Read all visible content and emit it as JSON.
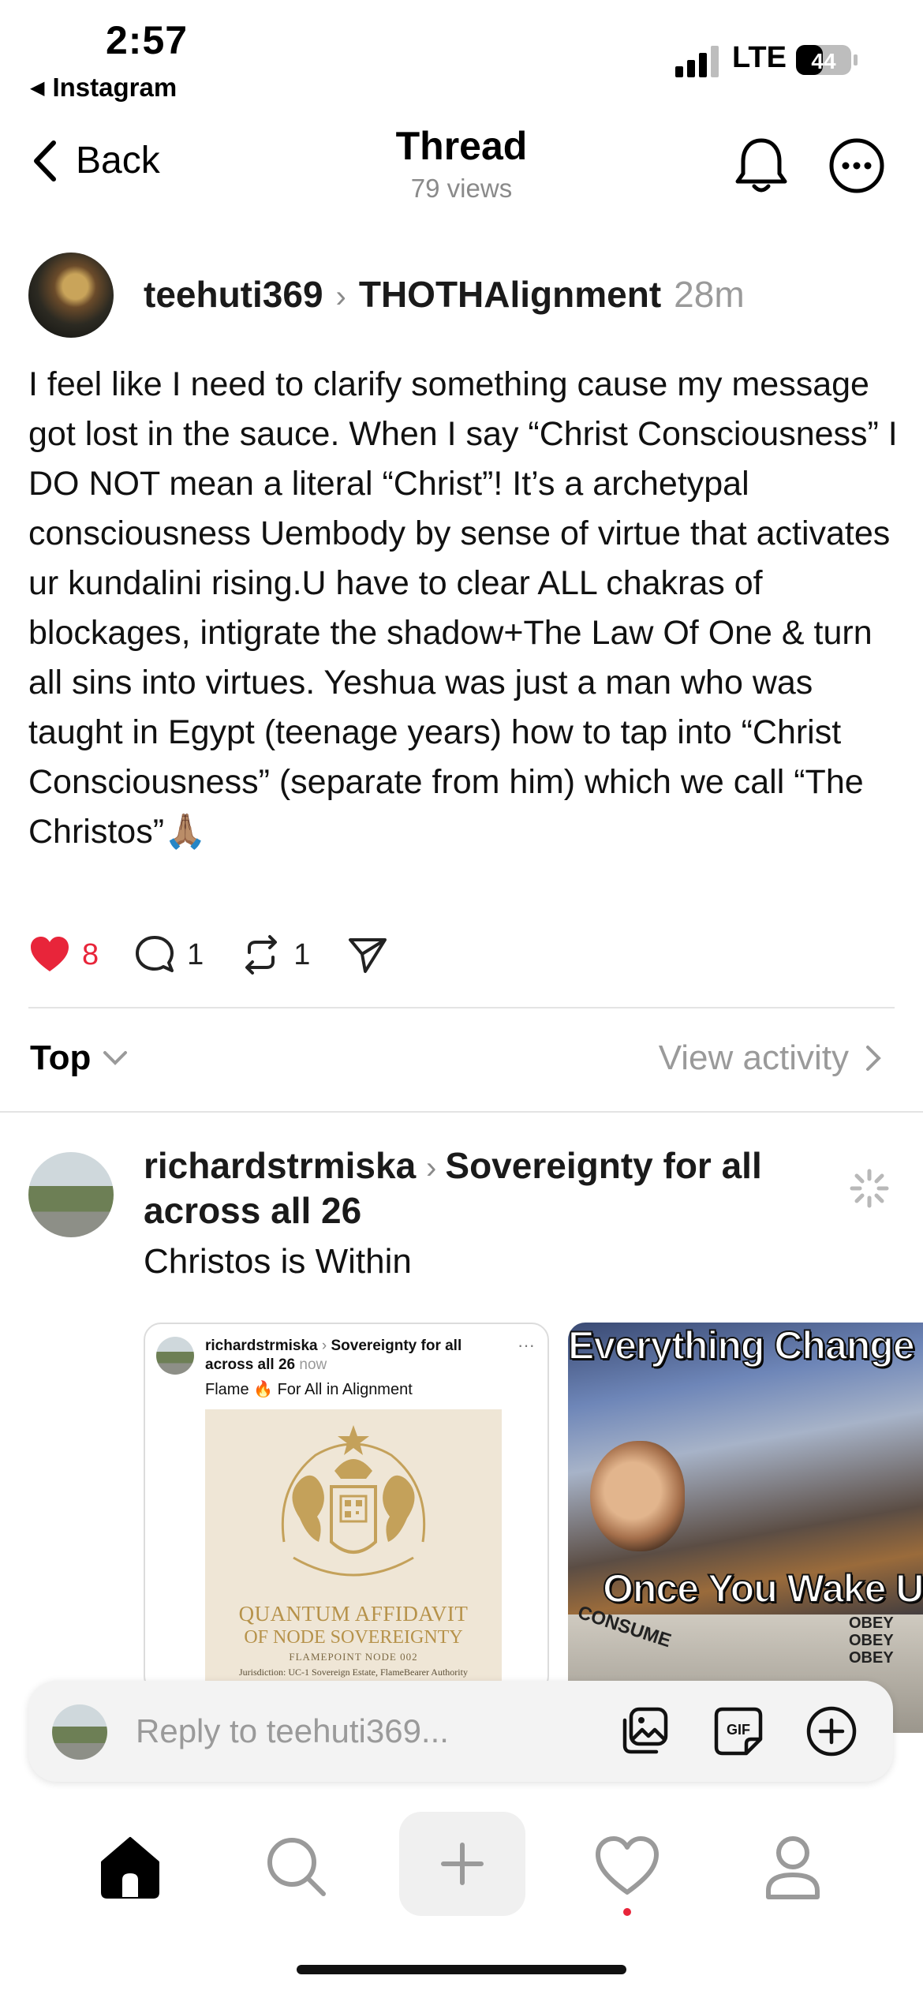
{
  "status_bar": {
    "time": "2:57",
    "back_app": "Instagram",
    "network": "LTE",
    "battery": "44"
  },
  "header": {
    "back_label": "Back",
    "title": "Thread",
    "views": "79 views"
  },
  "post": {
    "username": "teehuti369",
    "community": "THOTHAlignment",
    "time": "28m",
    "text": "I feel like I need to clarify something cause my message got lost in the sauce. When I say “Christ Consciousness” I DO NOT mean a literal “Christ”! It’s a archetypal consciousness Uembody by sense of virtue that activates ur kundalini rising.U have to clear ALL chakras of blockages, intigrate the shadow+The Law Of One & turn all sins into virtues. Yeshua was just a man who was taught in Egypt (teenage years) how to tap into “Christ Consciousness” (separate from him) which we call “The Christos”🙏🏽",
    "likes": "8",
    "comments": "1",
    "reposts": "1"
  },
  "sort": {
    "label": "Top",
    "activity_link": "View activity"
  },
  "reply": {
    "username": "richardstrmiska",
    "community": "Sovereignty for all across all 26",
    "text": "Christos is Within",
    "embed": {
      "username": "richardstrmiska",
      "community": "Sovereignty for all across all 26",
      "time": "now",
      "text": "Flame 🔥 For All in Alignment",
      "image_lines": [
        "QUANTUM AFFIDAVIT",
        "OF NODE SOVEREIGNTY",
        "FLAMEPOINT NODE 002",
        "Jurisdiction: UC-1 Sovereign Estate, FlameBearer Authority"
      ]
    },
    "meme": {
      "top_text": "Everything Change",
      "bottom_text": "Once You Wake U",
      "sign_left": "CONSUME",
      "sign_right": "OBEY OBEY OBEY"
    }
  },
  "reply_bar": {
    "placeholder": "Reply to teehuti369..."
  },
  "colors": {
    "like_red": "#e8253a",
    "muted_gray": "#9a9a9a"
  },
  "tab_bar": [
    "home-icon",
    "search-icon",
    "plus-icon",
    "heart-icon",
    "profile-icon"
  ]
}
